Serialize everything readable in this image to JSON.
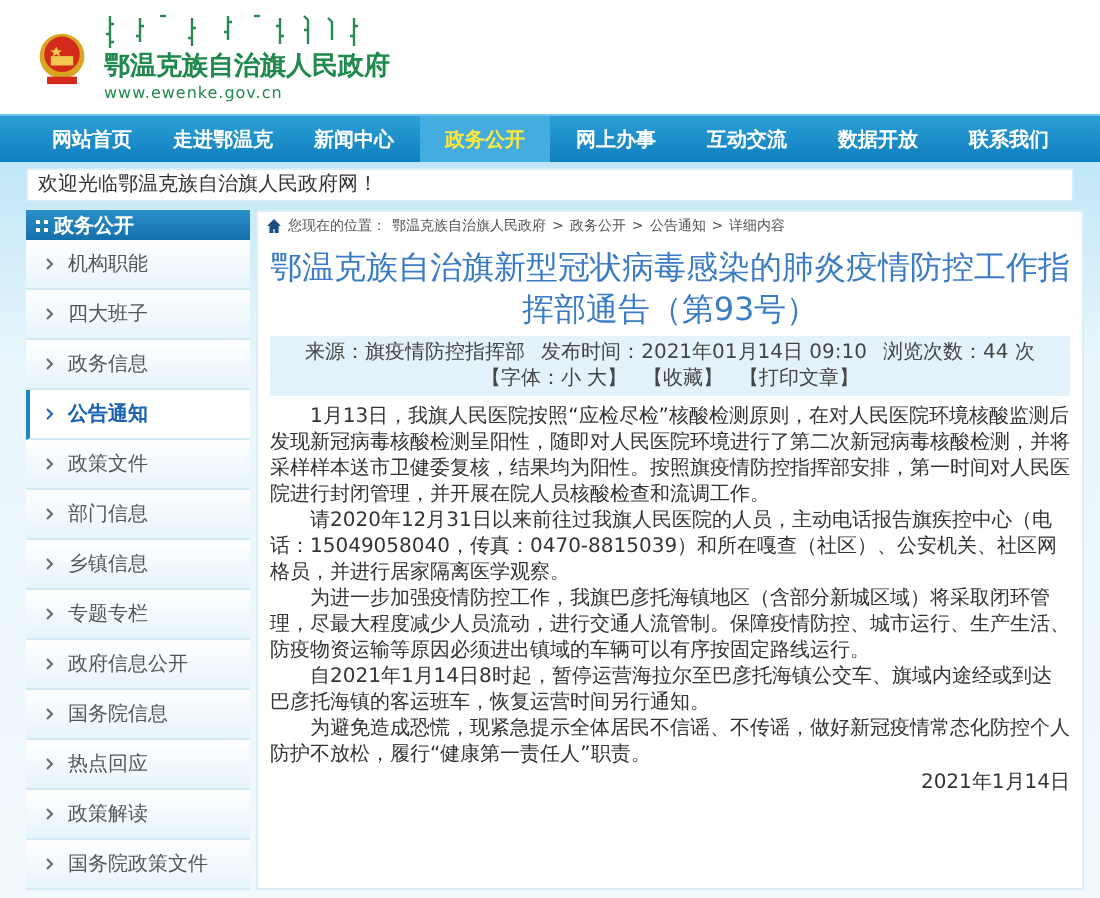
{
  "header": {
    "site_name": "鄂温克族自治旗人民政府",
    "url": "www.ewenke.gov.cn"
  },
  "nav": [
    {
      "label": "网站首页",
      "selected": false
    },
    {
      "label": "走进鄂温克",
      "selected": false
    },
    {
      "label": "新闻中心",
      "selected": false
    },
    {
      "label": "政务公开",
      "selected": true
    },
    {
      "label": "网上办事",
      "selected": false
    },
    {
      "label": "互动交流",
      "selected": false
    },
    {
      "label": "数据开放",
      "selected": false
    },
    {
      "label": "联系我们",
      "selected": false
    }
  ],
  "welcome": "欢迎光临鄂温克族自治旗人民政府网！",
  "sidebar": {
    "title": "政务公开",
    "items": [
      {
        "label": "机构职能",
        "selected": false
      },
      {
        "label": "四大班子",
        "selected": false
      },
      {
        "label": "政务信息",
        "selected": false
      },
      {
        "label": "公告通知",
        "selected": true
      },
      {
        "label": "政策文件",
        "selected": false
      },
      {
        "label": "部门信息",
        "selected": false
      },
      {
        "label": "乡镇信息",
        "selected": false
      },
      {
        "label": "专题专栏",
        "selected": false
      },
      {
        "label": "政府信息公开",
        "selected": false
      },
      {
        "label": "国务院信息",
        "selected": false
      },
      {
        "label": "热点回应",
        "selected": false
      },
      {
        "label": "政策解读",
        "selected": false
      },
      {
        "label": "国务院政策文件",
        "selected": false
      }
    ]
  },
  "breadcrumb": {
    "prefix": "您现在的位置：",
    "separator": ">",
    "links": [
      "鄂温克族自治旗人民政府",
      "政务公开",
      "公告通知",
      "详细内容"
    ]
  },
  "article": {
    "title": "鄂温克族自治旗新型冠状病毒感染的肺炎疫情防控工作指挥部通告（第93号）",
    "meta": [
      "来源：旗疫情防控指挥部",
      "发布时间：2021年01月14日 09:10",
      "浏览次数：44 次",
      "【字体：小 大】",
      "【收藏】",
      "【打印文章】"
    ],
    "paragraphs": [
      "1月13日，我旗人民医院按照“应检尽检”核酸检测原则，在对人民医院环境核酸监测后发现新冠病毒核酸检测呈阳性，随即对人民医院环境进行了第二次新冠病毒核酸检测，并将采样样本送市卫健委复核，结果均为阳性。按照旗疫情防控指挥部安排，第一时间对人民医院进行封闭管理，并开展在院人员核酸检查和流调工作。",
      "请2020年12月31日以来前往过我旗人民医院的人员，主动电话报告旗疾控中心（电话：15049058040，传真：0470-8815039）和所在嘎查（社区）、公安机关、社区网格员，并进行居家隔离医学观察。",
      "为进一步加强疫情防控工作，我旗巴彦托海镇地区（含部分新城区域）将采取闭环管理，尽最大程度减少人员流动，进行交通人流管制。保障疫情防控、城市运行、生产生活、防疫物资运输等原因必须进出镇域的车辆可以有序按固定路线运行。",
      "自2021年1月14日8时起，暂停运营海拉尔至巴彦托海镇公交车、旗域内途经或到达巴彦托海镇的客运班车，恢复运营时间另行通知。",
      "为避免造成恐慌，现紧急提示全体居民不信谣、不传谣，做好新冠疫情常态化防控个人防护不放松，履行“健康第一责任人”职责。"
    ],
    "date": "2021年1月14日"
  }
}
